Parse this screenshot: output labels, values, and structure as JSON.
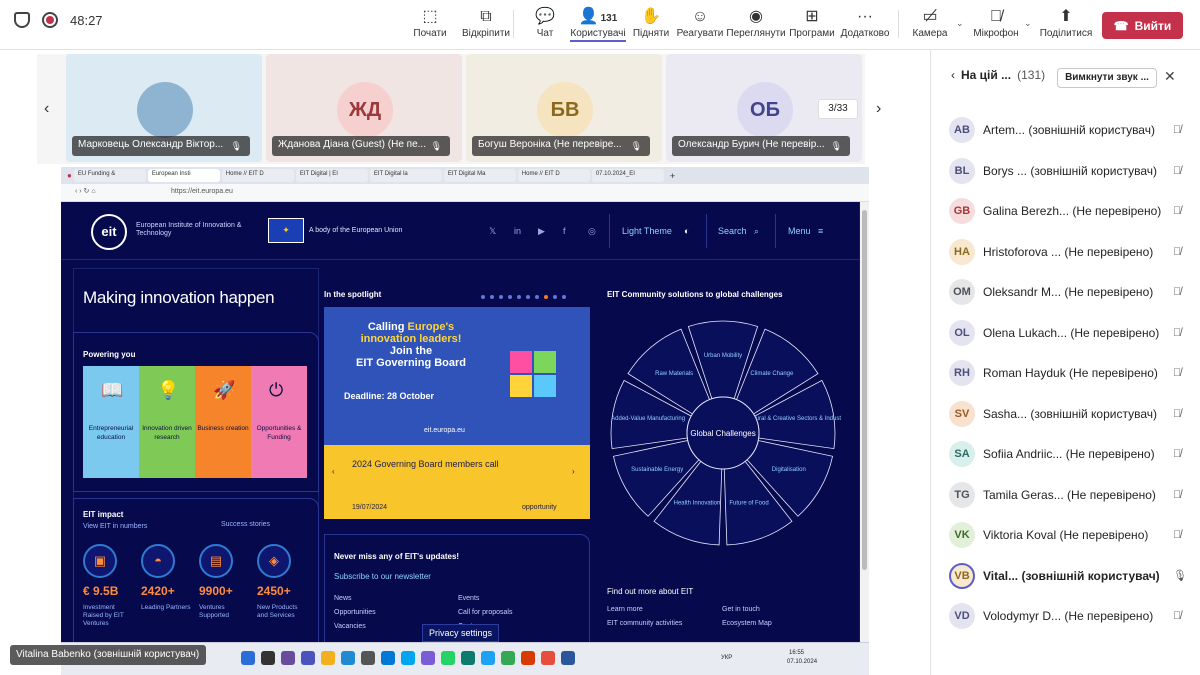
{
  "toolbar": {
    "timer": "48:27",
    "buttons": [
      {
        "id": "start",
        "label": "Почати",
        "glyph": "⬚"
      },
      {
        "id": "detach",
        "label": "Відкріпити",
        "glyph": "⧉"
      },
      {
        "id": "chat",
        "label": "Чат",
        "glyph": "💬"
      },
      {
        "id": "people",
        "label": "Користувачі",
        "glyph": "👤",
        "badge": "131"
      },
      {
        "id": "raise",
        "label": "Підняти",
        "glyph": "✋"
      },
      {
        "id": "react",
        "label": "Реагувати",
        "glyph": "☺"
      },
      {
        "id": "view",
        "label": "Переглянути",
        "glyph": "◉"
      },
      {
        "id": "apps",
        "label": "Програми",
        "glyph": "⊞"
      },
      {
        "id": "more",
        "label": "Додатково",
        "glyph": "···"
      },
      {
        "id": "camera",
        "label": "Камера",
        "glyph": "▭̸"
      },
      {
        "id": "mic",
        "label": "Мікрофон",
        "glyph": "🎙̸"
      },
      {
        "id": "share",
        "label": "Поділитися",
        "glyph": "⬆"
      }
    ],
    "leave_label": "Вийти"
  },
  "participants_strip": {
    "pager": "3/33",
    "tiles": [
      {
        "name": "Марковець Олександр Віктор...",
        "initials": "",
        "bg": "#dceaf3",
        "avbg": "#8fb4d2"
      },
      {
        "name": "Жданова Діана (Guest) (Не пе...",
        "initials": "ЖД",
        "bg": "#f0e5e2",
        "avbg": "#f6cfcf",
        "fg": "#9a3a3a"
      },
      {
        "name": "Богуш Вероніка (Не перевіре...",
        "initials": "БВ",
        "bg": "#f2ede2",
        "avbg": "#f6e3bf",
        "fg": "#8a6a1f"
      },
      {
        "name": "Олександр Бурич (Не перевір...",
        "initials": "ОБ",
        "bg": "#ebe9f2",
        "avbg": "#dcdaf0",
        "fg": "#43458c"
      }
    ]
  },
  "browser": {
    "tabs": [
      "EU Funding &",
      "European Insti",
      "Home // EIT D",
      "EIT Digital | EI",
      "EIT Digital la",
      "EIT Digital Ma",
      "Home // EIT D",
      "07.10.2024_EI"
    ],
    "url": "https://eit.europa.eu"
  },
  "site": {
    "eit_logo": "eit",
    "org_name": "European Institute of Innovation & Technology",
    "eu_body": "A body of the European Union",
    "light_theme": "Light Theme",
    "search": "Search",
    "menu": "Menu",
    "hero": "Making innovation happen",
    "powering": "Powering you",
    "cards": [
      {
        "label": "Entrepreneurial education",
        "color": "#7bc9ef",
        "icon": "📖"
      },
      {
        "label": "Innovation driven research",
        "color": "#7fc957",
        "icon": "💡"
      },
      {
        "label": "Business creation",
        "color": "#f6842a",
        "icon": "🚀"
      },
      {
        "label": "Opportunities & Funding",
        "color": "#f07ab3",
        "icon": "⏻"
      }
    ],
    "spotlight_title": "In the spotlight",
    "spot_line1": "Calling ",
    "spot_y1": "Europe's",
    "spot_y2": "innovation leaders!",
    "spot_line3": "Join the",
    "spot_line4": "EIT Governing Board",
    "deadline": "Deadline: 28 October",
    "spot_url": "eit.europa.eu",
    "news_title": "2024 Governing Board members call",
    "news_date": "19/07/2024",
    "news_tag": "opportunity",
    "community_title": "EIT Community solutions to global challenges",
    "wheel_center": "Global Challenges",
    "wheel_items": [
      "Urban Mobility",
      "Climate Change",
      "Cultural & Creative Sectors & Industries",
      "Digitalisation",
      "Future of Food",
      "Health Innovation",
      "Sustainable Energy",
      "Added-Value Manufacturing",
      "Raw Materials"
    ],
    "impact_title": "EIT impact",
    "view_numbers": "View EIT in numbers",
    "success": "Success stories",
    "stats": [
      {
        "value": "€ 9.5B",
        "label": "Investment Raised by EIT Ventures",
        "icon": "▣"
      },
      {
        "value": "2420+",
        "label": "Leading Partners",
        "icon": "◓"
      },
      {
        "value": "9900+",
        "label": "Ventures Supported",
        "icon": "▤"
      },
      {
        "value": "2450+",
        "label": "New Products and Services",
        "icon": "◈"
      }
    ],
    "updates_title": "Never miss any of EIT's updates!",
    "subscribe": "Subscribe to our newsletter",
    "links_left": [
      "News",
      "Opportunities",
      "Vacancies"
    ],
    "links_right": [
      "Events",
      "Call for proposals",
      "Centre"
    ],
    "find_more": "Find out more about EIT",
    "links_find": [
      "Learn more",
      "EIT community activities",
      "Get in touch",
      "Ecosystem Map"
    ],
    "privacy": "Privacy settings"
  },
  "taskbar": {
    "lang": "УКР",
    "time": "16:55",
    "date": "07.10.2024"
  },
  "share_name": "Vitalina Babenko (зовнішній користувач)",
  "panel": {
    "title": "На цій ...",
    "count": "(131)",
    "mute_all": "Вимкнути звук ...",
    "people": [
      {
        "ini": "AB",
        "name": "Artem... (зовнішній користувач)",
        "bg": "#e3e4f0",
        "fg": "#4d4f7c"
      },
      {
        "ini": "BL",
        "name": "Borys ... (зовнішній користувач)",
        "bg": "#e3e4f0",
        "fg": "#4d4f7c"
      },
      {
        "ini": "GB",
        "name": "Galina Berezh... (Не перевірено)",
        "bg": "#f6dcdc",
        "fg": "#a33a3a"
      },
      {
        "ini": "HA",
        "name": "Hristoforova ... (Не перевірено)",
        "bg": "#f7e8cf",
        "fg": "#8a6a1f"
      },
      {
        "ini": "OM",
        "name": "Oleksandr M... (Не перевірено)",
        "bg": "#e4e6e8",
        "fg": "#4c5257"
      },
      {
        "ini": "OL",
        "name": "Olena Lukach... (Не перевірено)",
        "bg": "#e3e4f0",
        "fg": "#4d4f7c"
      },
      {
        "ini": "RH",
        "name": "Roman Hayduk (Не перевірено)",
        "bg": "#e3e4f0",
        "fg": "#4d4f7c"
      },
      {
        "ini": "SV",
        "name": "Sasha... (зовнішній користувач)",
        "bg": "#f8e1cf",
        "fg": "#9a5a21"
      },
      {
        "ini": "SA",
        "name": "Sofiia Andriic... (Не перевірено)",
        "bg": "#d8efec",
        "fg": "#2a6b63"
      },
      {
        "ini": "TG",
        "name": "Tamila Geras... (Не перевірено)",
        "bg": "#e4e6e8",
        "fg": "#4c5257"
      },
      {
        "ini": "VK",
        "name": "Viktoria Koval (Не перевірено)",
        "bg": "#e2f0da",
        "fg": "#3f6b2a"
      },
      {
        "ini": "VB",
        "name": "Vital... (зовнішній користувач)",
        "bg": "#f7e8cf",
        "fg": "#8a6a1f"
      },
      {
        "ini": "VD",
        "name": "Volodymyr D... (Не перевірено)",
        "bg": "#e3e4f0",
        "fg": "#4d4f7c"
      }
    ]
  }
}
